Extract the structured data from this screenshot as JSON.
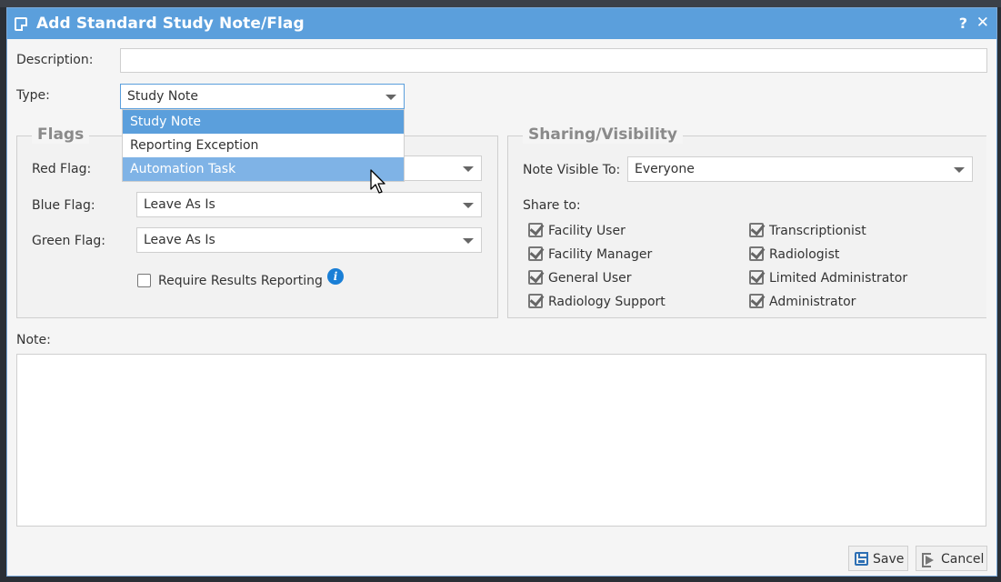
{
  "dialog": {
    "title": "Add Standard Study Note/Flag",
    "help_label": "?",
    "close_label": "✕"
  },
  "form": {
    "description_label": "Description:",
    "description_value": "",
    "type_label": "Type:",
    "type_value": "Study Note",
    "type_options": [
      "Study Note",
      "Reporting Exception",
      "Automation Task"
    ]
  },
  "flags": {
    "legend": "Flags",
    "red_label": "Red Flag:",
    "red_value": "",
    "blue_label": "Blue Flag:",
    "blue_value": "Leave As Is",
    "green_label": "Green Flag:",
    "green_value": "Leave As Is",
    "require_results_label": "Require Results Reporting",
    "require_results_checked": false,
    "info_icon": "i"
  },
  "sharing": {
    "legend": "Sharing/Visibility",
    "visible_to_label": "Note Visible To:",
    "visible_to_value": "Everyone",
    "share_to_label": "Share to:",
    "roles": [
      {
        "label": "Facility User",
        "checked": true
      },
      {
        "label": "Transcriptionist",
        "checked": true
      },
      {
        "label": "Facility Manager",
        "checked": true
      },
      {
        "label": "Radiologist",
        "checked": true
      },
      {
        "label": "General User",
        "checked": true
      },
      {
        "label": "Limited Administrator",
        "checked": true
      },
      {
        "label": "Radiology Support",
        "checked": true
      },
      {
        "label": "Administrator",
        "checked": true
      }
    ]
  },
  "note": {
    "label": "Note:",
    "value": ""
  },
  "buttons": {
    "save_label": "Save",
    "cancel_label": "Cancel"
  },
  "colors": {
    "titlebar": "#5b9fdc",
    "selected_option": "#5b9fdc",
    "hover_option": "#7fb3e6",
    "info_icon": "#1a7fd6"
  }
}
